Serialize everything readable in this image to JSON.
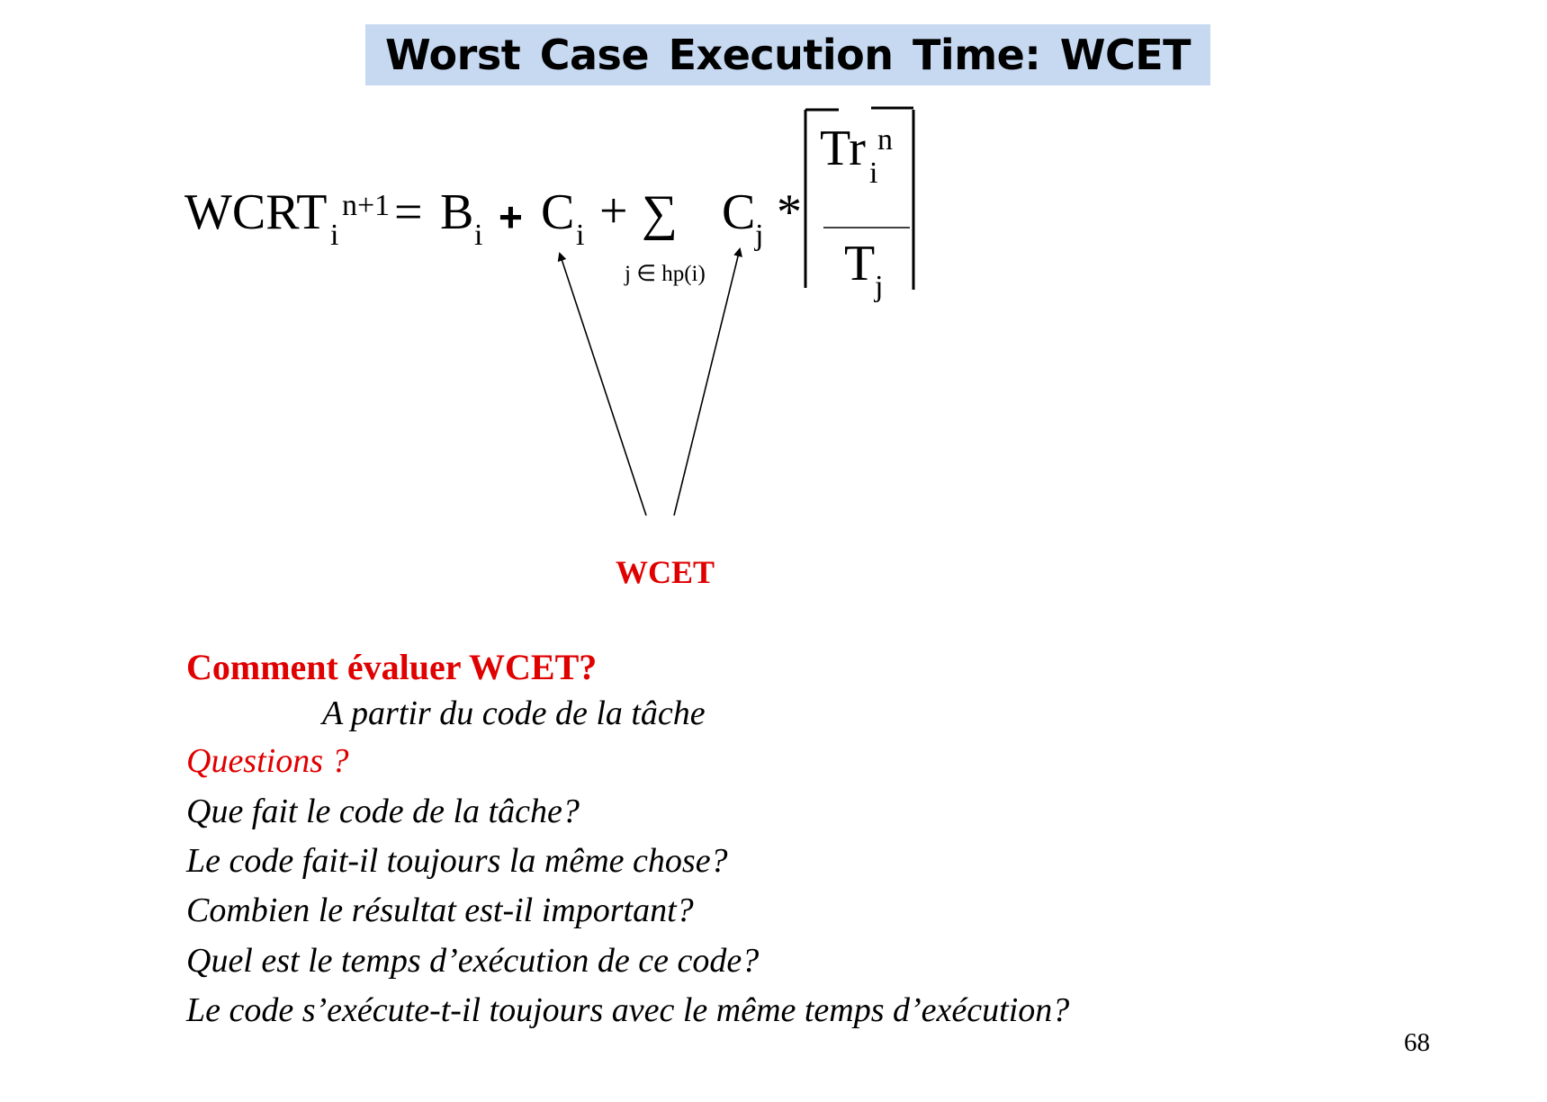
{
  "slide": {
    "title": "Worst Case Execution Time:  WCET",
    "page_number": "68"
  },
  "formula": {
    "lhs_base": "WCRT",
    "lhs_sup": "n+1",
    "lhs_sub": "i",
    "equals": "=",
    "b_base": "B",
    "b_sub": "i",
    "plus_bold": "+",
    "c_base": "C",
    "c_sub": "i",
    "plus": "+",
    "sigma": "∑",
    "sigma_range": "j ∈ hp(i)",
    "cj_base": "C",
    "cj_sub": "j",
    "times": "*",
    "num_base": "Tr",
    "num_sup": "n",
    "num_sub": "i",
    "den_base": "T",
    "den_sub": "j"
  },
  "annotation": {
    "label": "WCET"
  },
  "questions": {
    "heading": "Comment évaluer WCET?",
    "answer": "A partir du code de la tâche",
    "subheading": "Questions ?",
    "items": [
      "Que fait le code de la tâche?",
      "Le code fait-il toujours la même chose?",
      "Combien le résultat est-il important?",
      "Quel est le temps d’exécution de ce code?",
      "Le code s’exécute-t-il toujours avec le même temps d’exécution?"
    ]
  }
}
